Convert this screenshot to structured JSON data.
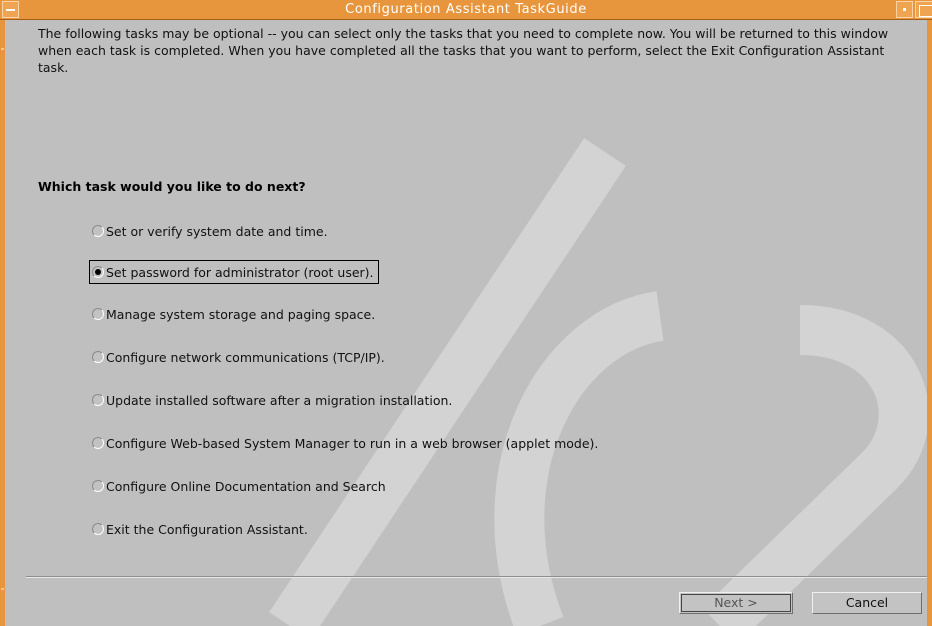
{
  "window": {
    "title": "Configuration Assistant TaskGuide",
    "menu_icon": "window-menu-icon",
    "minimize_icon": "minimize-icon",
    "maximize_icon": "maximize-icon"
  },
  "intro_text": "The following tasks may be optional -- you can select only the tasks that you need to complete now. You will be returned to this window when each task is completed.  When you have completed all the tasks that you want to perform, select the Exit Configuration Assistant task.",
  "question": "Which task would you like to do next?",
  "options": [
    {
      "label": "Set or verify system date and time.",
      "selected": false
    },
    {
      "label": "Set password for administrator (root user).",
      "selected": true
    },
    {
      "label": "Manage system storage and paging space.",
      "selected": false
    },
    {
      "label": "Configure network communications (TCP/IP).",
      "selected": false
    },
    {
      "label": "Update installed software after a migration installation.",
      "selected": false
    },
    {
      "label": "Configure Web-based System Manager to run in a web browser (applet mode).",
      "selected": false
    },
    {
      "label": "Configure Online Documentation and Search",
      "selected": false
    },
    {
      "label": "Exit the Configuration Assistant.",
      "selected": false
    }
  ],
  "buttons": {
    "next": "Next >",
    "cancel": "Cancel"
  },
  "colors": {
    "titlebar": "#e7963e",
    "background": "#bfbfbf"
  }
}
